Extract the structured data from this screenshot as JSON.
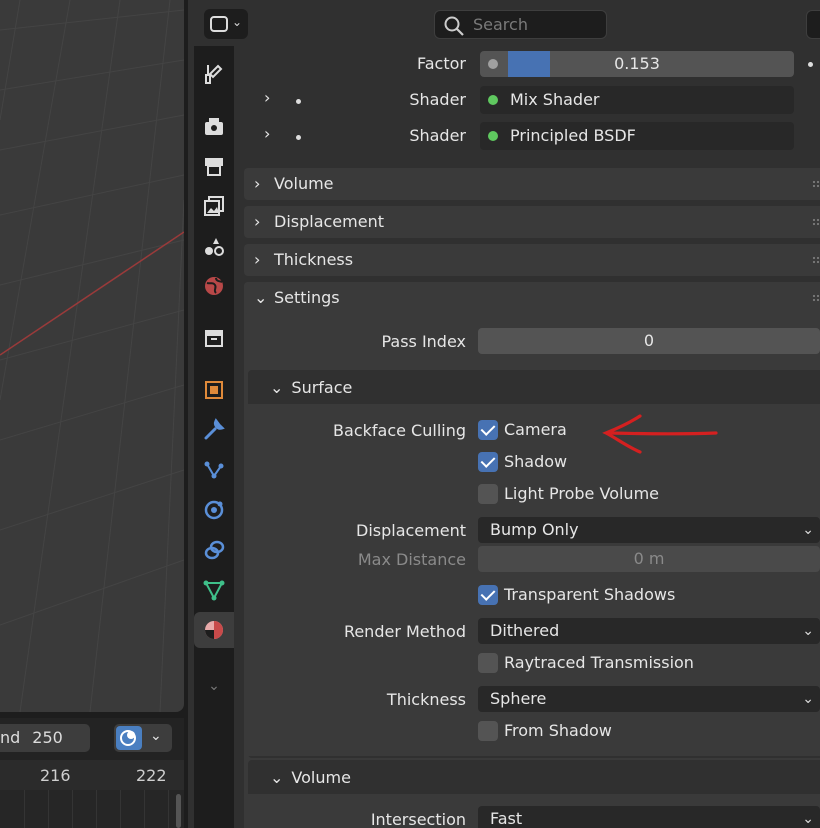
{
  "timeline": {
    "end_label": "nd",
    "end_value": "250",
    "ruler_ticks": [
      "216",
      "222"
    ]
  },
  "header": {
    "search_placeholder": "Search"
  },
  "node_inputs": {
    "factor": {
      "label": "Factor",
      "value": "0.153",
      "fraction": 0.153
    },
    "shader1": {
      "label": "Shader",
      "value": "Mix Shader"
    },
    "shader2": {
      "label": "Shader",
      "value": "Principled BSDF"
    }
  },
  "panels": {
    "volume": "Volume",
    "displacement": "Displacement",
    "thickness": "Thickness",
    "settings": "Settings"
  },
  "settings": {
    "pass_index": {
      "label": "Pass Index",
      "value": "0"
    },
    "surface": {
      "title": "Surface",
      "backface_culling_label": "Backface Culling",
      "camera": {
        "label": "Camera",
        "checked": true
      },
      "shadow": {
        "label": "Shadow",
        "checked": true
      },
      "light_probe_volume": {
        "label": "Light Probe Volume",
        "checked": false
      },
      "displacement_label": "Displacement",
      "displacement_value": "Bump Only",
      "max_distance_label": "Max Distance",
      "max_distance_value": "0 m",
      "transparent_shadows": {
        "label": "Transparent Shadows",
        "checked": true
      },
      "render_method_label": "Render Method",
      "render_method_value": "Dithered",
      "raytraced_transmission": {
        "label": "Raytraced Transmission",
        "checked": false
      },
      "thickness_label": "Thickness",
      "thickness_value": "Sphere",
      "from_shadow": {
        "label": "From Shadow",
        "checked": false
      }
    },
    "volume": {
      "title": "Volume",
      "intersection_label": "Intersection",
      "intersection_value": "Fast"
    }
  },
  "colors": {
    "accent": "#4772b3",
    "annotation": "#d42020",
    "socket_green": "#5fc85f"
  },
  "tab_icons": [
    "tool-icon",
    "render-icon",
    "output-icon",
    "view-layer-icon",
    "scene-icon",
    "world-icon",
    "collection-icon",
    "object-icon",
    "modifier-icon",
    "particles-icon",
    "physics-icon",
    "constraints-icon",
    "data-icon",
    "material-icon",
    "more-icon"
  ]
}
